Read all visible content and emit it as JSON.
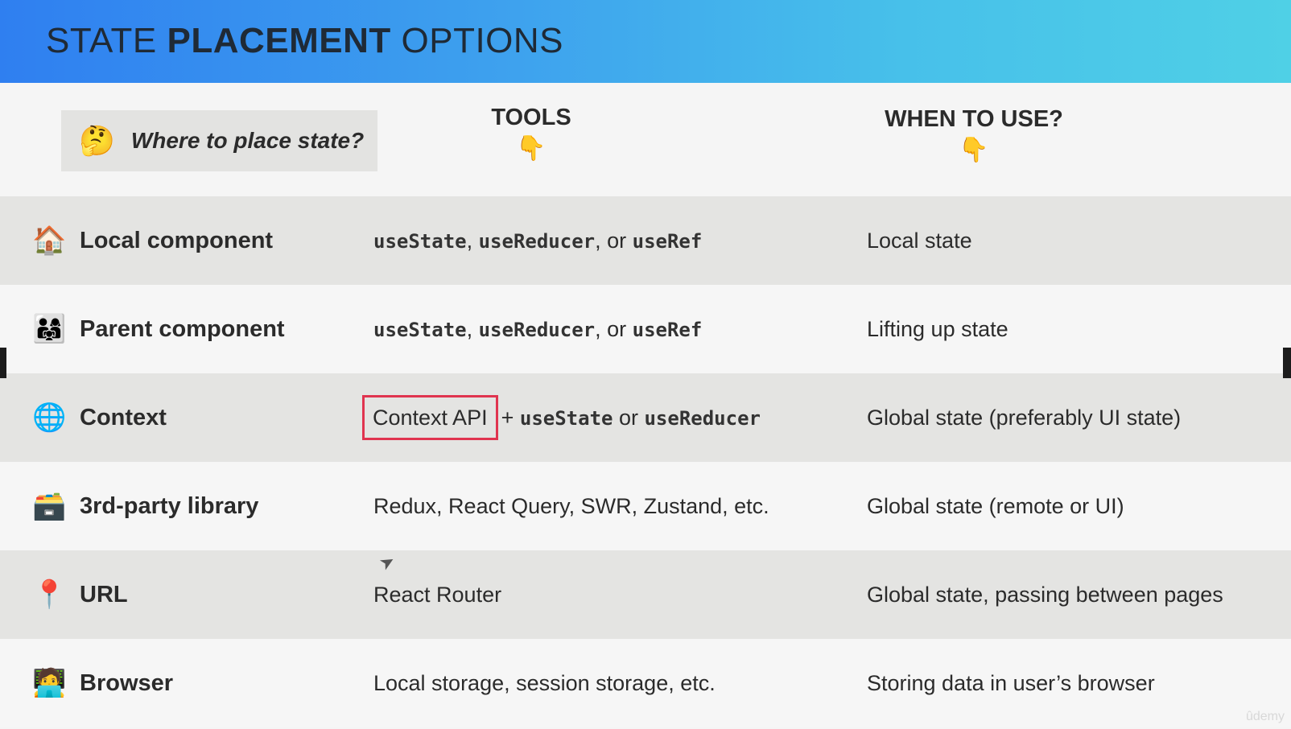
{
  "header": {
    "title_part1": "STATE ",
    "title_part2": "PLACEMENT",
    "title_part3": " OPTIONS"
  },
  "question": {
    "emoji": "🤔",
    "text": "Where to place state?"
  },
  "columns": {
    "tools": "TOOLS",
    "when": "WHEN TO USE?",
    "pointer": "👇"
  },
  "rows": [
    {
      "icon": "🏠",
      "name": "Local component",
      "tools": {
        "a": "useState",
        "b": ", ",
        "c": "useReducer",
        "d": ", or ",
        "e": "useRef"
      },
      "when": "Local state"
    },
    {
      "icon": "👨‍👩‍👧",
      "name": "Parent component",
      "tools": {
        "a": "useState",
        "b": ", ",
        "c": "useReducer",
        "d": ", or ",
        "e": "useRef"
      },
      "when": "Lifting up state"
    },
    {
      "icon": "🌐",
      "name": "Context",
      "tools": {
        "highlight": "Context API",
        "b": "+ ",
        "c": "useState",
        "d": " or ",
        "e": "useReducer"
      },
      "when": "Global state (preferably UI state)"
    },
    {
      "icon": "🗃️",
      "name": "3rd-party library",
      "tools_text": "Redux, React Query, SWR, Zustand, etc.",
      "when": "Global state (remote or UI)"
    },
    {
      "icon": "📍",
      "name": "URL",
      "tools_text": "React Router",
      "when": "Global state, passing between pages"
    },
    {
      "icon": "🧑‍💻",
      "name": "Browser",
      "tools_text": "Local storage, session storage, etc.",
      "when": "Storing data in user’s browser"
    }
  ],
  "watermark": "ûdemy",
  "colors": {
    "highlight_border": "#e0344f",
    "banner_start": "#2f7ff0",
    "banner_end": "#4fd0e6"
  }
}
